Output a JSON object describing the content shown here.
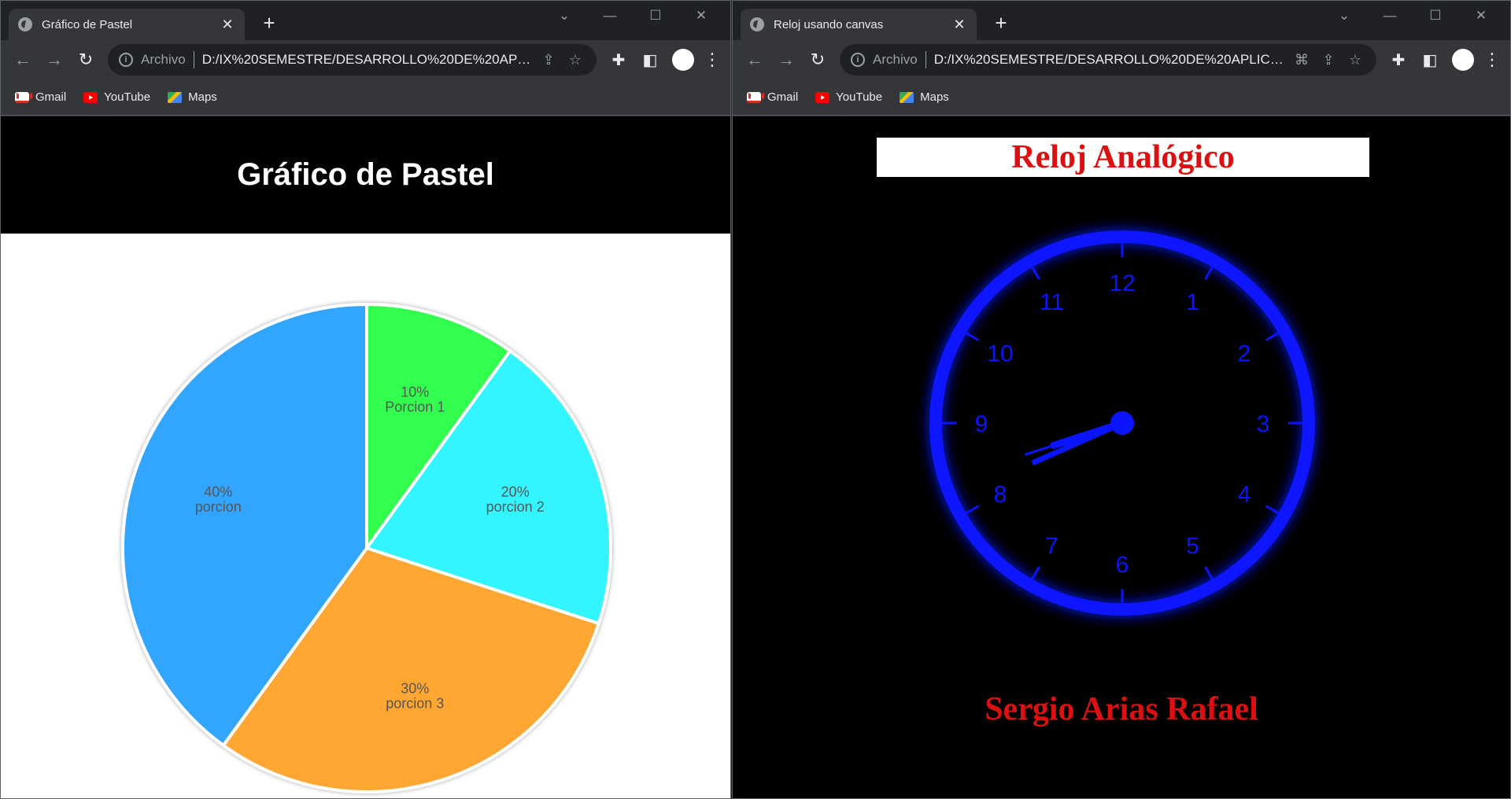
{
  "left_window": {
    "tab_title": "Gráfico de Pastel",
    "omnibox": {
      "scheme": "Archivo",
      "url": "D:/IX%20SEMESTRE/DESARROLLO%20DE%20APLIC..."
    },
    "bookmarks": [
      "Gmail",
      "YouTube",
      "Maps"
    ],
    "page_title": "Gráfico de Pastel"
  },
  "right_window": {
    "tab_title": "Reloj usando canvas",
    "omnibox": {
      "scheme": "Archivo",
      "url": "D:/IX%20SEMESTRE/DESARROLLO%20DE%20APLICAC..."
    },
    "bookmarks": [
      "Gmail",
      "YouTube",
      "Maps"
    ],
    "page_title": "Reloj Analógico",
    "author": "Sergio Arias Rafael",
    "clock": {
      "numbers": [
        "12",
        "1",
        "2",
        "3",
        "4",
        "5",
        "6",
        "7",
        "8",
        "9",
        "10",
        "11"
      ],
      "hour": 8.4,
      "minute": 41,
      "second": 42,
      "color": "#0a14ff"
    }
  },
  "chart_data": {
    "type": "pie",
    "title": "Gráfico de Pastel",
    "slices": [
      {
        "name": "Porcion 1",
        "value": 10,
        "label": "10%",
        "color": "#33ff4d"
      },
      {
        "name": "porcion 2",
        "value": 20,
        "label": "20%",
        "color": "#33f5ff"
      },
      {
        "name": "porcion 3",
        "value": 30,
        "label": "30%",
        "color": "#ffa733"
      },
      {
        "name": "porcion",
        "value": 40,
        "label": "40%",
        "color": "#33a6ff"
      }
    ],
    "start_angle": "top",
    "direction": "clockwise"
  }
}
